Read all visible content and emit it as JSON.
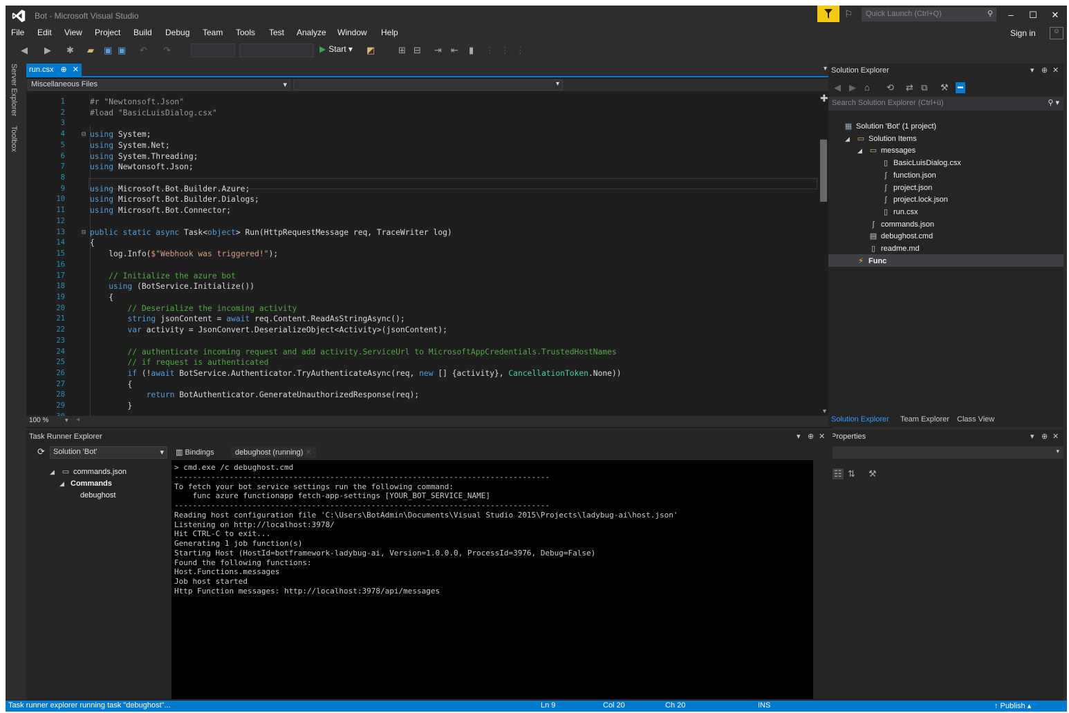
{
  "window": {
    "title": "Bot - Microsoft Visual Studio",
    "quick_launch_placeholder": "Quick Launch (Ctrl+Q)",
    "sign_in": "Sign in",
    "minimize": "‒",
    "maximize": "☐",
    "close": "✕"
  },
  "menu": [
    "File",
    "Edit",
    "View",
    "Project",
    "Build",
    "Debug",
    "Team",
    "Tools",
    "Test",
    "Analyze",
    "Window",
    "Help"
  ],
  "toolbar": {
    "start_label": "Start"
  },
  "side_tabs": [
    "Server Explorer",
    "Toolbox"
  ],
  "editor": {
    "tab_label": "run.csx",
    "nav_project": "Miscellaneous Files",
    "zoom": "100 %",
    "lines": [
      [
        [
          "pp",
          "#r \"Newtonsoft.Json\""
        ]
      ],
      [
        [
          "pp",
          "#load \"BasicLuisDialog.csx\""
        ]
      ],
      [],
      [
        [
          "kw",
          "using"
        ],
        [
          "pl",
          " System;"
        ]
      ],
      [
        [
          "kw",
          "using"
        ],
        [
          "pl",
          " System.Net;"
        ]
      ],
      [
        [
          "kw",
          "using"
        ],
        [
          "pl",
          " System.Threading;"
        ]
      ],
      [
        [
          "kw",
          "using"
        ],
        [
          "pl",
          " Newtonsoft.Json;"
        ]
      ],
      [],
      [
        [
          "kw",
          "using"
        ],
        [
          "pl",
          " Microsoft.Bot.Builder.Azure;"
        ]
      ],
      [
        [
          "kw",
          "using"
        ],
        [
          "pl",
          " Microsoft.Bot.Builder.Dialogs;"
        ]
      ],
      [
        [
          "kw",
          "using"
        ],
        [
          "pl",
          " Microsoft.Bot.Connector;"
        ]
      ],
      [],
      [
        [
          "kw",
          "public static async "
        ],
        [
          "pl",
          "Task<"
        ],
        [
          "kw",
          "object"
        ],
        [
          "pl",
          "> Run(HttpRequestMessage req, TraceWriter log)"
        ]
      ],
      [
        [
          "pl",
          "{"
        ]
      ],
      [
        [
          "pl",
          "    log.Info("
        ],
        [
          "str",
          "$\"Webhook was triggered!\""
        ],
        [
          "pl",
          ");"
        ]
      ],
      [],
      [
        [
          "cm",
          "    // Initialize the azure bot"
        ]
      ],
      [
        [
          "kw",
          "    using"
        ],
        [
          "pl",
          " (BotService.Initialize())"
        ]
      ],
      [
        [
          "pl",
          "    {"
        ]
      ],
      [
        [
          "cm",
          "        // Deserialize the incoming activity"
        ]
      ],
      [
        [
          "kw",
          "        string"
        ],
        [
          "pl",
          " jsonContent = "
        ],
        [
          "kw",
          "await"
        ],
        [
          "pl",
          " req.Content.ReadAsStringAsync();"
        ]
      ],
      [
        [
          "kw",
          "        var"
        ],
        [
          "pl",
          " activity = JsonConvert.DeserializeObject<Activity>(jsonContent);"
        ]
      ],
      [],
      [
        [
          "cm",
          "        // authenticate incoming request and add activity.ServiceUrl to MicrosoftAppCredentials.TrustedHostNames"
        ]
      ],
      [
        [
          "cm",
          "        // if request is authenticated"
        ]
      ],
      [
        [
          "kw",
          "        if"
        ],
        [
          "pl",
          " (!"
        ],
        [
          "kw",
          "await"
        ],
        [
          "pl",
          " BotService.Authenticator.TryAuthenticateAsync(req, "
        ],
        [
          "kw",
          "new"
        ],
        [
          "pl",
          " [] {activity}, "
        ],
        [
          "ty",
          "CancellationToken"
        ],
        [
          "pl",
          ".None))"
        ]
      ],
      [
        [
          "pl",
          "        {"
        ]
      ],
      [
        [
          "kw",
          "            return"
        ],
        [
          "pl",
          " BotAuthenticator.GenerateUnauthorizedResponse(req);"
        ]
      ],
      [
        [
          "pl",
          "        }"
        ]
      ],
      []
    ]
  },
  "solution_explorer": {
    "title": "Solution Explorer",
    "search_placeholder": "Search Solution Explorer (Ctrl+ü)",
    "items": [
      {
        "label": "Solution 'Bot' (1 project)",
        "icon": "solution-icon",
        "level": 0
      },
      {
        "label": "Solution Items",
        "icon": "folder-icon",
        "level": 1,
        "arrow": "◢"
      },
      {
        "label": "messages",
        "icon": "folder-icon",
        "level": 2,
        "arrow": "◢"
      },
      {
        "label": "BasicLuisDialog.csx",
        "icon": "file-icon",
        "level": 3
      },
      {
        "label": "function.json",
        "icon": "json-file-icon",
        "level": 3
      },
      {
        "label": "project.json",
        "icon": "json-file-icon",
        "level": 3
      },
      {
        "label": "project.lock.json",
        "icon": "json-file-icon",
        "level": 3
      },
      {
        "label": "run.csx",
        "icon": "file-icon",
        "level": 3
      },
      {
        "label": "commands.json",
        "icon": "json-file-icon",
        "level": 2
      },
      {
        "label": "debughost.cmd",
        "icon": "cmd-file-icon",
        "level": 2
      },
      {
        "label": "readme.md",
        "icon": "file-icon",
        "level": 2
      },
      {
        "label": "Func",
        "icon": "lightning-icon",
        "level": 1
      }
    ],
    "tabs": [
      "Solution Explorer",
      "Team Explorer",
      "Class View"
    ]
  },
  "properties": {
    "title": "Properties"
  },
  "task_runner": {
    "title": "Task Runner Explorer",
    "solution_select": "Solution 'Bot'",
    "tree": [
      {
        "label": "commands.json",
        "level": 0,
        "arrow": "◢"
      },
      {
        "label": "Commands",
        "level": 1,
        "arrow": "◢",
        "bold": true
      },
      {
        "label": "debughost",
        "level": 2
      }
    ],
    "tabs": [
      "Bindings",
      "debughost (running)"
    ],
    "console_lines": [
      "> cmd.exe /c debughost.cmd",
      "----------------------------------------------------------------------------------",
      "To fetch your bot service settings run the following command:",
      "    func azure functionapp fetch-app-settings [YOUR_BOT_SERVICE_NAME]",
      "----------------------------------------------------------------------------------",
      "Reading host configuration file 'C:\\Users\\BotAdmin\\Documents\\Visual Studio 2015\\Projects\\ladybug-ai\\host.json'",
      "Listening on http://localhost:3978/",
      "Hit CTRL-C to exit...",
      "Generating 1 job function(s)",
      "Starting Host (HostId=botframework-ladybug-ai, Version=1.0.0.0, ProcessId=3976, Debug=False)",
      "Found the following functions:",
      "Host.Functions.messages",
      "Job host started",
      "Http Function messages: http://localhost:3978/api/messages"
    ]
  },
  "status": {
    "message": "Task runner explorer running task \"debughost\"...",
    "ln": "Ln 9",
    "col": "Col 20",
    "ch": "Ch 20",
    "ins": "INS",
    "publish": "↑  Publish  ▴"
  },
  "colors": {
    "accent": "#007acc",
    "background": "#2d2d30",
    "editor": "#1e1e1e",
    "notify": "#f2c811"
  }
}
